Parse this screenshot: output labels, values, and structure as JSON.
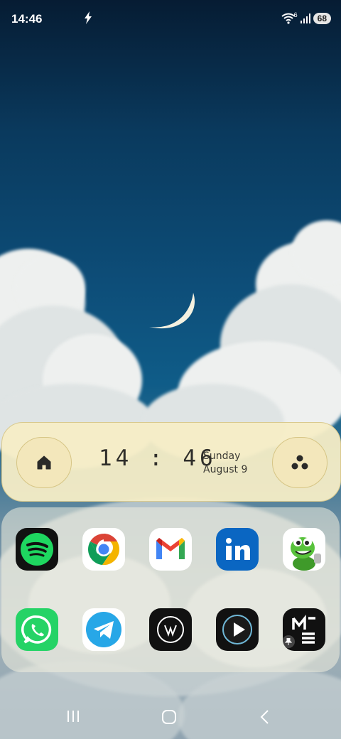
{
  "status_bar": {
    "time": "14:46",
    "wifi_badge": "6",
    "battery": "68",
    "icons": [
      "bolt-icon",
      "wifi-icon",
      "signal-icon",
      "battery-icon"
    ]
  },
  "clock_widget": {
    "time": "14 : 46",
    "day": "Sunday",
    "date": "August 9",
    "left_button_icon": "home-icon",
    "right_button_icon": "three-dots-icon"
  },
  "apps": {
    "row1": [
      "Spotify",
      "Chrome",
      "Gmail",
      "LinkedIn",
      "Green alien mascot"
    ],
    "row2": [
      "WhatsApp",
      "Telegram",
      "W app",
      "Play app",
      "ME app"
    ]
  },
  "nav_bar": {
    "icons": [
      "recents-icon",
      "home-nav-icon",
      "back-icon"
    ]
  },
  "colors": {
    "spotify": "#1ed760",
    "whatsapp": "#25d366",
    "telegram": "#27a7e7",
    "linkedin": "#0a66c2",
    "widget": "#f6edc6"
  }
}
